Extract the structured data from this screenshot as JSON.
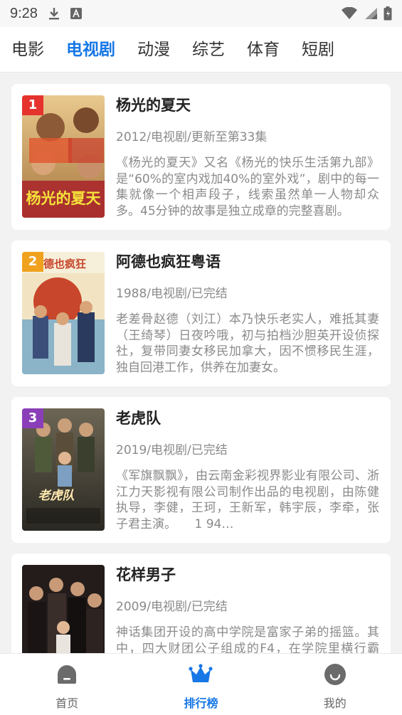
{
  "status": {
    "time": "9:28",
    "icons": [
      "download-icon",
      "a-icon",
      "wifi-icon",
      "signal-icon",
      "battery-icon"
    ]
  },
  "tabs": [
    {
      "label": "电影",
      "active": false
    },
    {
      "label": "电视剧",
      "active": true
    },
    {
      "label": "动漫",
      "active": false
    },
    {
      "label": "综艺",
      "active": false
    },
    {
      "label": "体育",
      "active": false
    },
    {
      "label": "短剧",
      "active": false
    }
  ],
  "items": [
    {
      "rank": "1",
      "rank_color": "#e5322d",
      "title": "杨光的夏天",
      "meta": "2012/电视剧/更新至第33集",
      "desc": "《杨光的夏天》又名《杨光的快乐生活第九部》是“60%的室内戏加40%的室外戏”，剧中的每一集就像一个相声段子，线索虽然单一人物却众多。45分钟的故事是独立成章的完整喜剧。",
      "poster_text": "杨光的夏天",
      "poster_colors": [
        "#c9a46a",
        "#e2c27f",
        "#b88a4c"
      ]
    },
    {
      "rank": "2",
      "rank_color": "#f0a21e",
      "title": "阿德也疯狂粤语",
      "meta": "1988/电视剧/已完结",
      "desc": "老差骨赵德（刘江）本乃快乐老实人，难抵其妻（王绮琴）日夜吟哦，初与拍档沙胆英开设侦探社，复带同妻女移民加拿大，因不惯移民生涯，独自回港工作，供养在加妻女。",
      "poster_text": "德也疯狂",
      "poster_colors": [
        "#f3e6c9",
        "#c8462b",
        "#3b4f7a"
      ]
    },
    {
      "rank": "3",
      "rank_color": "#8a3fb8",
      "title": "老虎队",
      "meta": "2019/电视剧/已完结",
      "desc": "《军旗飘飘》，由云南金彩视界影业有限公司、浙江力天影视有限公司制作出品的电视剧，由陈健执导，李健，王珂，王新军，韩宇辰，李牵，张子君主演。　　1 94…",
      "poster_text": "老虎队",
      "poster_colors": [
        "#4b4536",
        "#6e6450",
        "#2b2a26"
      ]
    },
    {
      "rank": "",
      "rank_color": "",
      "title": "花样男子",
      "meta": "2009/电视剧/已完结",
      "desc": "神话集团开设的高中学院是富家子弟的摇篮。其中，四大财团公子组成的F4，在学院里横行霸道，无人敢惹。",
      "poster_text": "",
      "poster_colors": [
        "#2a2222",
        "#4a3a32",
        "#1a1414"
      ]
    }
  ],
  "bottom_nav": [
    {
      "label": "首页",
      "icon": "home-icon",
      "active": false
    },
    {
      "label": "排行榜",
      "icon": "crown-icon",
      "active": true
    },
    {
      "label": "我的",
      "icon": "profile-icon",
      "active": false
    }
  ],
  "colors": {
    "accent": "#1677e6"
  }
}
